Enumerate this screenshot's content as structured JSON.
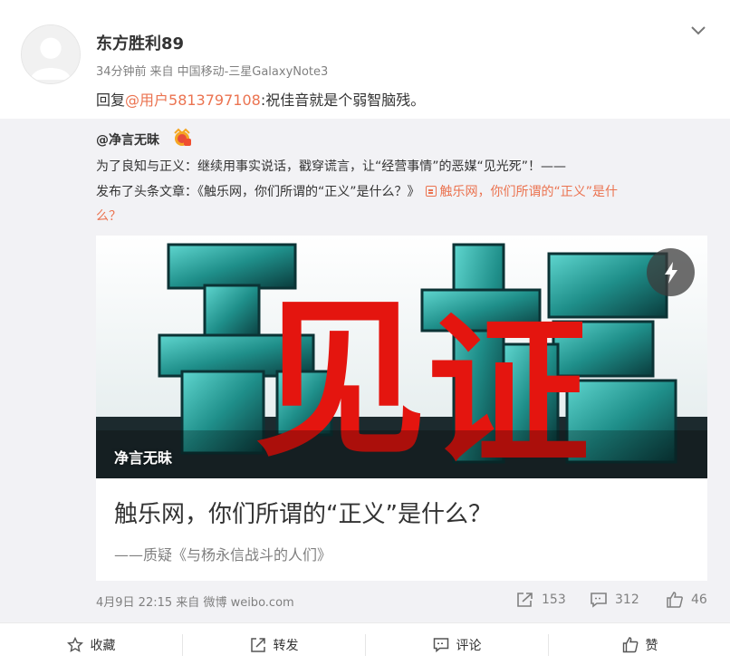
{
  "post": {
    "username": "东方胜利89",
    "time": "34分钟前",
    "source_prefix": "来自",
    "source": "中国移动-三星GalaxyNote3",
    "reply_prefix": "回复",
    "reply_mention": "@用户5813797108",
    "reply_text": ":祝佳音就是个弱智脑残。"
  },
  "repost": {
    "author": "@净言无昧",
    "line1": "为了良知与正义：继续用事实说话，戳穿谎言，让“经营事情”的恶媒“见光死”！——",
    "line2_prefix": "发布了头条文章：《触乐网，你们所谓的“正义”是什么？》",
    "line2_link": "触乐网，你们所谓的“正义”是什",
    "line3_link": "么？",
    "article": {
      "cover_label": "净言无昧",
      "cover_chars": [
        "见",
        "证"
      ],
      "title": "触乐网，你们所谓的“正义”是什么？",
      "subtitle": "——质疑《与杨永信战斗的人们》"
    },
    "time": "4月9日 22:15",
    "source_prefix": "来自",
    "source": "微博 weibo.com",
    "reposts": "153",
    "comments": "312",
    "likes": "46"
  },
  "actions": {
    "favorite": "收藏",
    "repost": "转发",
    "comment": "评论",
    "like": "赞"
  },
  "colors": {
    "mention": "#eb7350",
    "repost_bg": "#f2f2f5",
    "cover_red": "#e4150f",
    "cover_teal": "#2fb3ad"
  }
}
